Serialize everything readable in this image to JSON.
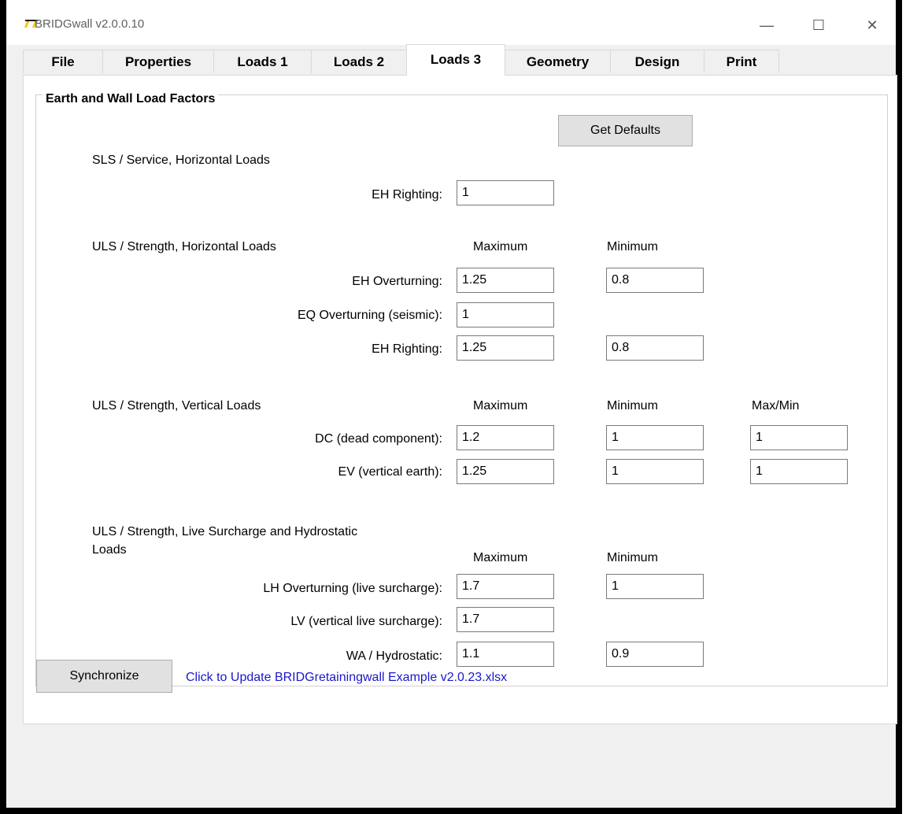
{
  "window": {
    "title": "BRIDGwall v2.0.0.10",
    "controls": {
      "minimize": "—",
      "maximize": "☐",
      "close": "✕"
    }
  },
  "tabs": [
    "File",
    "Properties",
    "Loads 1",
    "Loads 2",
    "Loads 3",
    "Geometry",
    "Design",
    "Print"
  ],
  "active_tab": "Loads 3",
  "group": {
    "title": "Earth and Wall Load Factors",
    "get_defaults": "Get Defaults"
  },
  "sls_horizontal": {
    "heading": "SLS / Service, Horizontal Loads",
    "eh_righting_label": "EH Righting:",
    "eh_righting": "1"
  },
  "uls_horizontal": {
    "heading": "ULS / Strength, Horizontal Loads",
    "max_header": "Maximum",
    "min_header": "Minimum",
    "eh_overturning_label": "EH Overturning:",
    "eh_overturning_max": "1.25",
    "eh_overturning_min": "0.8",
    "eq_overturning_label": "EQ Overturning (seismic):",
    "eq_overturning_max": "1",
    "eh_righting_label": "EH Righting:",
    "eh_righting_max": "1.25",
    "eh_righting_min": "0.8"
  },
  "uls_vertical": {
    "heading": "ULS / Strength, Vertical Loads",
    "max_header": "Maximum",
    "min_header": "Minimum",
    "maxmin_header": "Max/Min",
    "dc_label": "DC (dead component):",
    "dc_max": "1.2",
    "dc_min": "1",
    "dc_maxmin": "1",
    "ev_label": "EV (vertical earth):",
    "ev_max": "1.25",
    "ev_min": "1",
    "ev_maxmin": "1"
  },
  "uls_live": {
    "heading_line1": "ULS / Strength, Live Surcharge and Hydrostatic",
    "heading_line2": "Loads",
    "max_header": "Maximum",
    "min_header": "Minimum",
    "lh_label": "LH Overturning (live surcharge):",
    "lh_max": "1.7",
    "lh_min": "1",
    "lv_label": "LV (vertical live surcharge):",
    "lv_max": "1.7",
    "wa_label": "WA / Hydrostatic:",
    "wa_max": "1.1",
    "wa_min": "0.9"
  },
  "footer": {
    "synchronize": "Synchronize",
    "link": "Click to Update BRIDGretainingwall Example v2.0.23.xlsx"
  }
}
